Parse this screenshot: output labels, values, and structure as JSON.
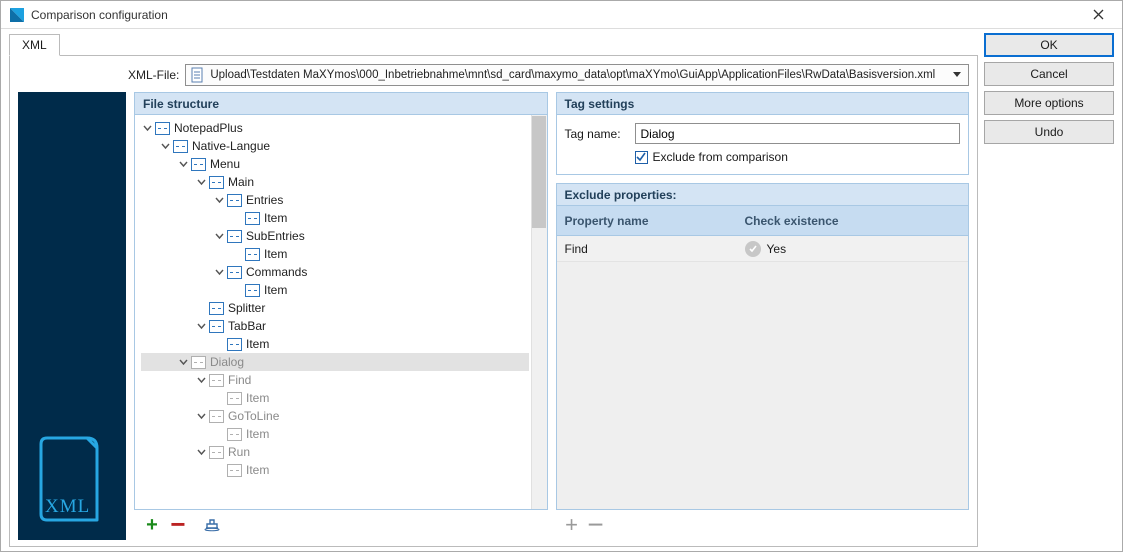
{
  "window": {
    "title": "Comparison configuration"
  },
  "buttons": {
    "ok": "OK",
    "cancel": "Cancel",
    "more": "More options",
    "undo": "Undo"
  },
  "tabs": {
    "xml": "XML"
  },
  "xml_file": {
    "label": "XML-File:",
    "path": "Upload\\Testdaten MaXYmos\\000_Inbetriebnahme\\mnt\\sd_card\\maxymo_data\\opt\\maXYmo\\GuiApp\\ApplicationFiles\\RwData\\Basisversion.xml"
  },
  "panels": {
    "file_structure": "File structure",
    "tag_settings": "Tag settings",
    "exclude_properties": "Exclude properties:"
  },
  "tree": {
    "nodes": [
      {
        "depth": 0,
        "expanded": true,
        "label": "NotepadPlus",
        "excluded": false
      },
      {
        "depth": 1,
        "expanded": true,
        "label": "Native-Langue",
        "excluded": false
      },
      {
        "depth": 2,
        "expanded": true,
        "label": "Menu",
        "excluded": false
      },
      {
        "depth": 3,
        "expanded": true,
        "label": "Main",
        "excluded": false
      },
      {
        "depth": 4,
        "expanded": true,
        "label": "Entries",
        "excluded": false
      },
      {
        "depth": 5,
        "expanded": null,
        "label": "Item",
        "excluded": false
      },
      {
        "depth": 4,
        "expanded": true,
        "label": "SubEntries",
        "excluded": false
      },
      {
        "depth": 5,
        "expanded": null,
        "label": "Item",
        "excluded": false
      },
      {
        "depth": 4,
        "expanded": true,
        "label": "Commands",
        "excluded": false
      },
      {
        "depth": 5,
        "expanded": null,
        "label": "Item",
        "excluded": false
      },
      {
        "depth": 3,
        "expanded": null,
        "label": "Splitter",
        "excluded": false
      },
      {
        "depth": 3,
        "expanded": true,
        "label": "TabBar",
        "excluded": false
      },
      {
        "depth": 4,
        "expanded": null,
        "label": "Item",
        "excluded": false
      },
      {
        "depth": 2,
        "expanded": true,
        "label": "Dialog",
        "excluded": true,
        "selected": true
      },
      {
        "depth": 3,
        "expanded": true,
        "label": "Find",
        "excluded": true
      },
      {
        "depth": 4,
        "expanded": null,
        "label": "Item",
        "excluded": true
      },
      {
        "depth": 3,
        "expanded": true,
        "label": "GoToLine",
        "excluded": true
      },
      {
        "depth": 4,
        "expanded": null,
        "label": "Item",
        "excluded": true
      },
      {
        "depth": 3,
        "expanded": true,
        "label": "Run",
        "excluded": true
      },
      {
        "depth": 4,
        "expanded": null,
        "label": "Item",
        "excluded": true
      }
    ]
  },
  "tag_settings": {
    "tag_name_label": "Tag name:",
    "tag_name_value": "Dialog",
    "exclude_label": "Exclude from comparison",
    "exclude_checked": true
  },
  "exclude_table": {
    "headers": {
      "property": "Property name",
      "check": "Check existence"
    },
    "rows": [
      {
        "property": "Find",
        "check": "Yes"
      }
    ]
  },
  "icons": {
    "plus": "+",
    "minus": "−"
  }
}
